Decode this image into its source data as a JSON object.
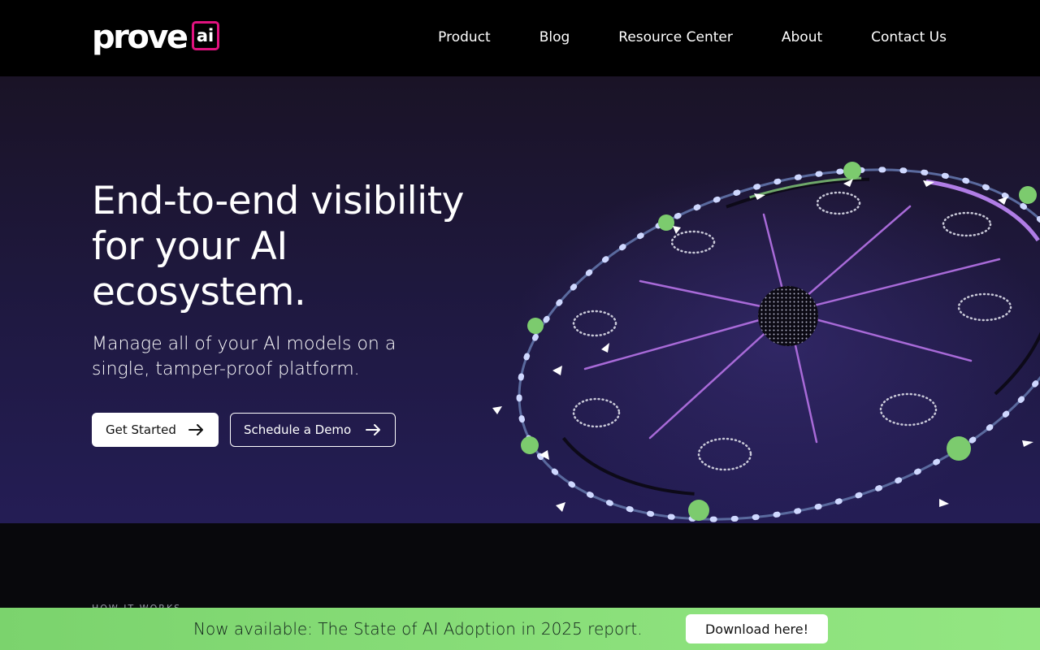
{
  "brand": {
    "logo_word": "prove",
    "logo_badge": "ai",
    "accent": "#e0127f"
  },
  "nav": {
    "items": [
      {
        "label": "Product"
      },
      {
        "label": "Blog"
      },
      {
        "label": "Resource Center"
      },
      {
        "label": "About"
      },
      {
        "label": "Contact Us"
      }
    ]
  },
  "hero": {
    "title": "End-to-end visibility for your AI ecosystem.",
    "subtitle": "Manage all of your AI models on a single, tamper-proof platform.",
    "primary_button": "Get Started",
    "secondary_button": "Schedule a Demo",
    "arrow_icon": "arrow-right-icon"
  },
  "section": {
    "label": "HOW IT WORKS"
  },
  "banner": {
    "text": "Now available: The State of AI Adoption in 2025 report.",
    "button": "Download here!",
    "color": "#8be07b"
  },
  "colors": {
    "ring": "#5a6a9e",
    "spoke": "#a86ad8",
    "node": "#7ccb6e"
  }
}
